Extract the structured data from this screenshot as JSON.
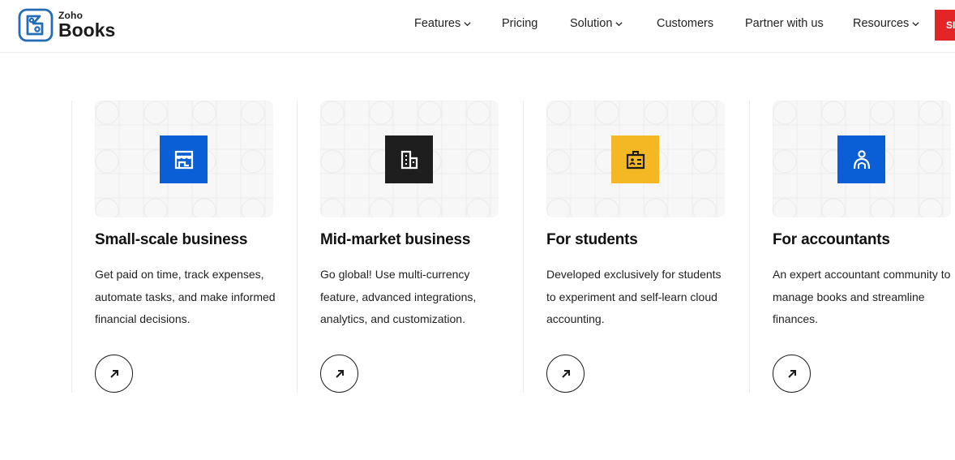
{
  "brand": {
    "line1": "Zoho",
    "line2": "Books",
    "icon": "books-logo-icon",
    "color": "#226DB4"
  },
  "nav": [
    {
      "label": "Features",
      "dropdown": true
    },
    {
      "label": "Pricing",
      "dropdown": false
    },
    {
      "label": "Solution",
      "dropdown": true
    },
    {
      "label": "Customers",
      "dropdown": false
    },
    {
      "label": "Partner with us",
      "dropdown": false
    },
    {
      "label": "Resources",
      "dropdown": true
    }
  ],
  "signup": {
    "label": "SI",
    "color": "#E42527"
  },
  "cards": [
    {
      "title": "Small-scale business",
      "description": "Get paid on time, track expenses, automate tasks, and make informed financial decisions.",
      "icon": "storefront-icon",
      "icon_color": "#0B5FD6"
    },
    {
      "title": "Mid-market business",
      "description": "Go global! Use multi-currency feature, advanced integrations, analytics, and customization.",
      "icon": "building-icon",
      "icon_color": "#1E1E1E"
    },
    {
      "title": "For students",
      "description": "Developed exclusively for students to experiment and self-learn cloud accounting.",
      "icon": "student-id-icon",
      "icon_color": "#F4B824"
    },
    {
      "title": "For accountants",
      "description": "An expert accountant community to manage books and streamline finances.",
      "icon": "accountant-icon",
      "icon_color": "#0B5FD6"
    }
  ],
  "card_action_icon": "arrow-up-right-icon"
}
